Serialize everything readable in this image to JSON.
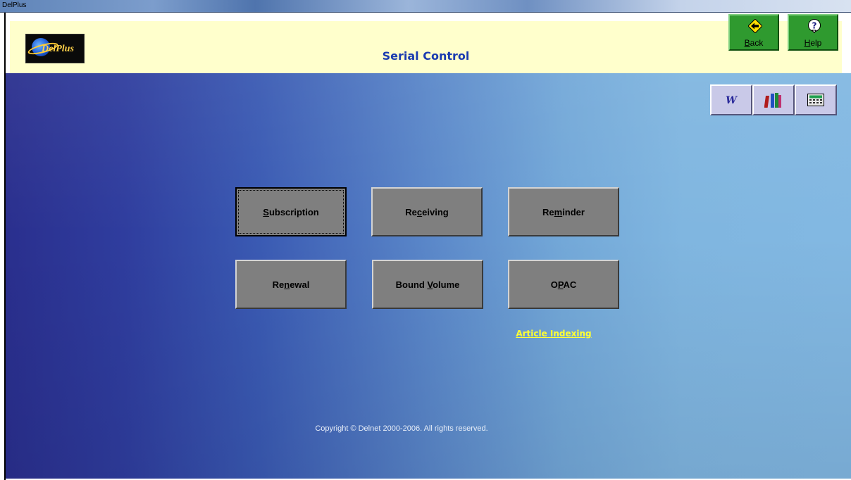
{
  "window": {
    "title": "DelPlus"
  },
  "header": {
    "logo_text": "DelPlus",
    "page_title": "Serial Control",
    "back": {
      "prefix": "",
      "mnemonic": "B",
      "suffix": "ack"
    },
    "help": {
      "prefix": "",
      "mnemonic": "H",
      "suffix": "elp"
    }
  },
  "toolbar": {
    "word_label": "W",
    "icons": [
      "word-icon",
      "books-icon",
      "calculator-icon"
    ]
  },
  "buttons": {
    "subscription": {
      "prefix": "",
      "mnemonic": "S",
      "suffix": "ubscription"
    },
    "receiving": {
      "prefix": "Re",
      "mnemonic": "c",
      "suffix": "eiving"
    },
    "reminder": {
      "prefix": "Re",
      "mnemonic": "m",
      "suffix": "inder"
    },
    "renewal": {
      "prefix": "Re",
      "mnemonic": "n",
      "suffix": "ewal"
    },
    "bound_volume": {
      "prefix": "Bound ",
      "mnemonic": "V",
      "suffix": "olume"
    },
    "opac": {
      "prefix": "O",
      "mnemonic": "P",
      "suffix": "AC"
    }
  },
  "links": {
    "article_indexing": "Article Indexing"
  },
  "footer": {
    "copyright": "Copyright © Delnet 2000-2006. All rights reserved."
  },
  "colors": {
    "header_bg": "#ffffcc",
    "title_color": "#1a3bb0",
    "button_gray": "#7f7f7f",
    "green_button": "#2f9a2f",
    "link_yellow": "#ffff33"
  }
}
